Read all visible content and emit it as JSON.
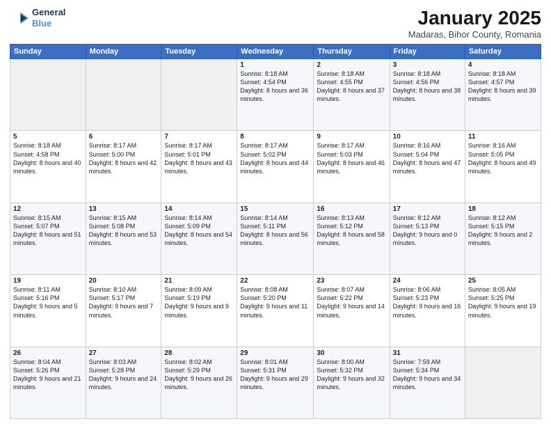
{
  "header": {
    "logo_line1": "General",
    "logo_line2": "Blue",
    "title": "January 2025",
    "subtitle": "Madaras, Bihor County, Romania"
  },
  "days_of_week": [
    "Sunday",
    "Monday",
    "Tuesday",
    "Wednesday",
    "Thursday",
    "Friday",
    "Saturday"
  ],
  "weeks": [
    [
      {
        "num": "",
        "info": ""
      },
      {
        "num": "",
        "info": ""
      },
      {
        "num": "",
        "info": ""
      },
      {
        "num": "1",
        "info": "Sunrise: 8:18 AM\nSunset: 4:54 PM\nDaylight: 8 hours and 36 minutes."
      },
      {
        "num": "2",
        "info": "Sunrise: 8:18 AM\nSunset: 4:55 PM\nDaylight: 8 hours and 37 minutes."
      },
      {
        "num": "3",
        "info": "Sunrise: 8:18 AM\nSunset: 4:56 PM\nDaylight: 8 hours and 38 minutes."
      },
      {
        "num": "4",
        "info": "Sunrise: 8:18 AM\nSunset: 4:57 PM\nDaylight: 8 hours and 39 minutes."
      }
    ],
    [
      {
        "num": "5",
        "info": "Sunrise: 8:18 AM\nSunset: 4:58 PM\nDaylight: 8 hours and 40 minutes."
      },
      {
        "num": "6",
        "info": "Sunrise: 8:17 AM\nSunset: 5:00 PM\nDaylight: 8 hours and 42 minutes."
      },
      {
        "num": "7",
        "info": "Sunrise: 8:17 AM\nSunset: 5:01 PM\nDaylight: 8 hours and 43 minutes."
      },
      {
        "num": "8",
        "info": "Sunrise: 8:17 AM\nSunset: 5:02 PM\nDaylight: 8 hours and 44 minutes."
      },
      {
        "num": "9",
        "info": "Sunrise: 8:17 AM\nSunset: 5:03 PM\nDaylight: 8 hours and 46 minutes."
      },
      {
        "num": "10",
        "info": "Sunrise: 8:16 AM\nSunset: 5:04 PM\nDaylight: 8 hours and 47 minutes."
      },
      {
        "num": "11",
        "info": "Sunrise: 8:16 AM\nSunset: 5:05 PM\nDaylight: 8 hours and 49 minutes."
      }
    ],
    [
      {
        "num": "12",
        "info": "Sunrise: 8:15 AM\nSunset: 5:07 PM\nDaylight: 8 hours and 51 minutes."
      },
      {
        "num": "13",
        "info": "Sunrise: 8:15 AM\nSunset: 5:08 PM\nDaylight: 8 hours and 53 minutes."
      },
      {
        "num": "14",
        "info": "Sunrise: 8:14 AM\nSunset: 5:09 PM\nDaylight: 8 hours and 54 minutes."
      },
      {
        "num": "15",
        "info": "Sunrise: 8:14 AM\nSunset: 5:11 PM\nDaylight: 8 hours and 56 minutes."
      },
      {
        "num": "16",
        "info": "Sunrise: 8:13 AM\nSunset: 5:12 PM\nDaylight: 8 hours and 58 minutes."
      },
      {
        "num": "17",
        "info": "Sunrise: 8:12 AM\nSunset: 5:13 PM\nDaylight: 9 hours and 0 minutes."
      },
      {
        "num": "18",
        "info": "Sunrise: 8:12 AM\nSunset: 5:15 PM\nDaylight: 9 hours and 2 minutes."
      }
    ],
    [
      {
        "num": "19",
        "info": "Sunrise: 8:11 AM\nSunset: 5:16 PM\nDaylight: 9 hours and 5 minutes."
      },
      {
        "num": "20",
        "info": "Sunrise: 8:10 AM\nSunset: 5:17 PM\nDaylight: 9 hours and 7 minutes."
      },
      {
        "num": "21",
        "info": "Sunrise: 8:09 AM\nSunset: 5:19 PM\nDaylight: 9 hours and 9 minutes."
      },
      {
        "num": "22",
        "info": "Sunrise: 8:08 AM\nSunset: 5:20 PM\nDaylight: 9 hours and 11 minutes."
      },
      {
        "num": "23",
        "info": "Sunrise: 8:07 AM\nSunset: 5:22 PM\nDaylight: 9 hours and 14 minutes."
      },
      {
        "num": "24",
        "info": "Sunrise: 8:06 AM\nSunset: 5:23 PM\nDaylight: 9 hours and 16 minutes."
      },
      {
        "num": "25",
        "info": "Sunrise: 8:05 AM\nSunset: 5:25 PM\nDaylight: 9 hours and 19 minutes."
      }
    ],
    [
      {
        "num": "26",
        "info": "Sunrise: 8:04 AM\nSunset: 5:26 PM\nDaylight: 9 hours and 21 minutes."
      },
      {
        "num": "27",
        "info": "Sunrise: 8:03 AM\nSunset: 5:28 PM\nDaylight: 9 hours and 24 minutes."
      },
      {
        "num": "28",
        "info": "Sunrise: 8:02 AM\nSunset: 5:29 PM\nDaylight: 9 hours and 26 minutes."
      },
      {
        "num": "29",
        "info": "Sunrise: 8:01 AM\nSunset: 5:31 PM\nDaylight: 9 hours and 29 minutes."
      },
      {
        "num": "30",
        "info": "Sunrise: 8:00 AM\nSunset: 5:32 PM\nDaylight: 9 hours and 32 minutes."
      },
      {
        "num": "31",
        "info": "Sunrise: 7:59 AM\nSunset: 5:34 PM\nDaylight: 9 hours and 34 minutes."
      },
      {
        "num": "",
        "info": ""
      }
    ]
  ]
}
